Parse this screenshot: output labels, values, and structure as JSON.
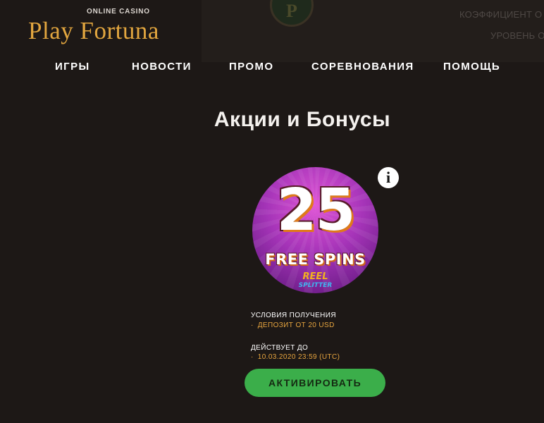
{
  "header": {
    "logo_sub": "ONLINE CASINO",
    "logo_main": "Play Fortuna",
    "coin_letter": "P",
    "coefficient_label": "КОЭФФИЦИЕНТ О",
    "level_label": "УРОВЕНЬ О"
  },
  "nav": {
    "items": [
      {
        "label": "ИГРЫ"
      },
      {
        "label": "НОВОСТИ"
      },
      {
        "label": "ПРОМО"
      },
      {
        "label": "СОРЕВНОВАНИЯ"
      },
      {
        "label": "ПОМОЩЬ"
      }
    ]
  },
  "main": {
    "title": "Акции и Бонусы",
    "promo": {
      "number": "25",
      "subtitle": "FREE SPINS",
      "game_line1": "REEL",
      "game_line2": "SPLITTER",
      "info_icon": "i"
    },
    "conditions_label": "УСЛОВИЯ ПОЛУЧЕНИЯ",
    "conditions_value": "ДЕПОЗИТ ОТ 20 USD",
    "valid_label": "ДЕЙСТВУЕТ ДО",
    "valid_value": "10.03.2020 23:59 (UTC)",
    "bullet": "·",
    "activate_label": "АКТИВИРОВАТЬ"
  },
  "colors": {
    "background": "#1d1816",
    "accent": "#e2a63f",
    "button": "#3bae4a"
  }
}
